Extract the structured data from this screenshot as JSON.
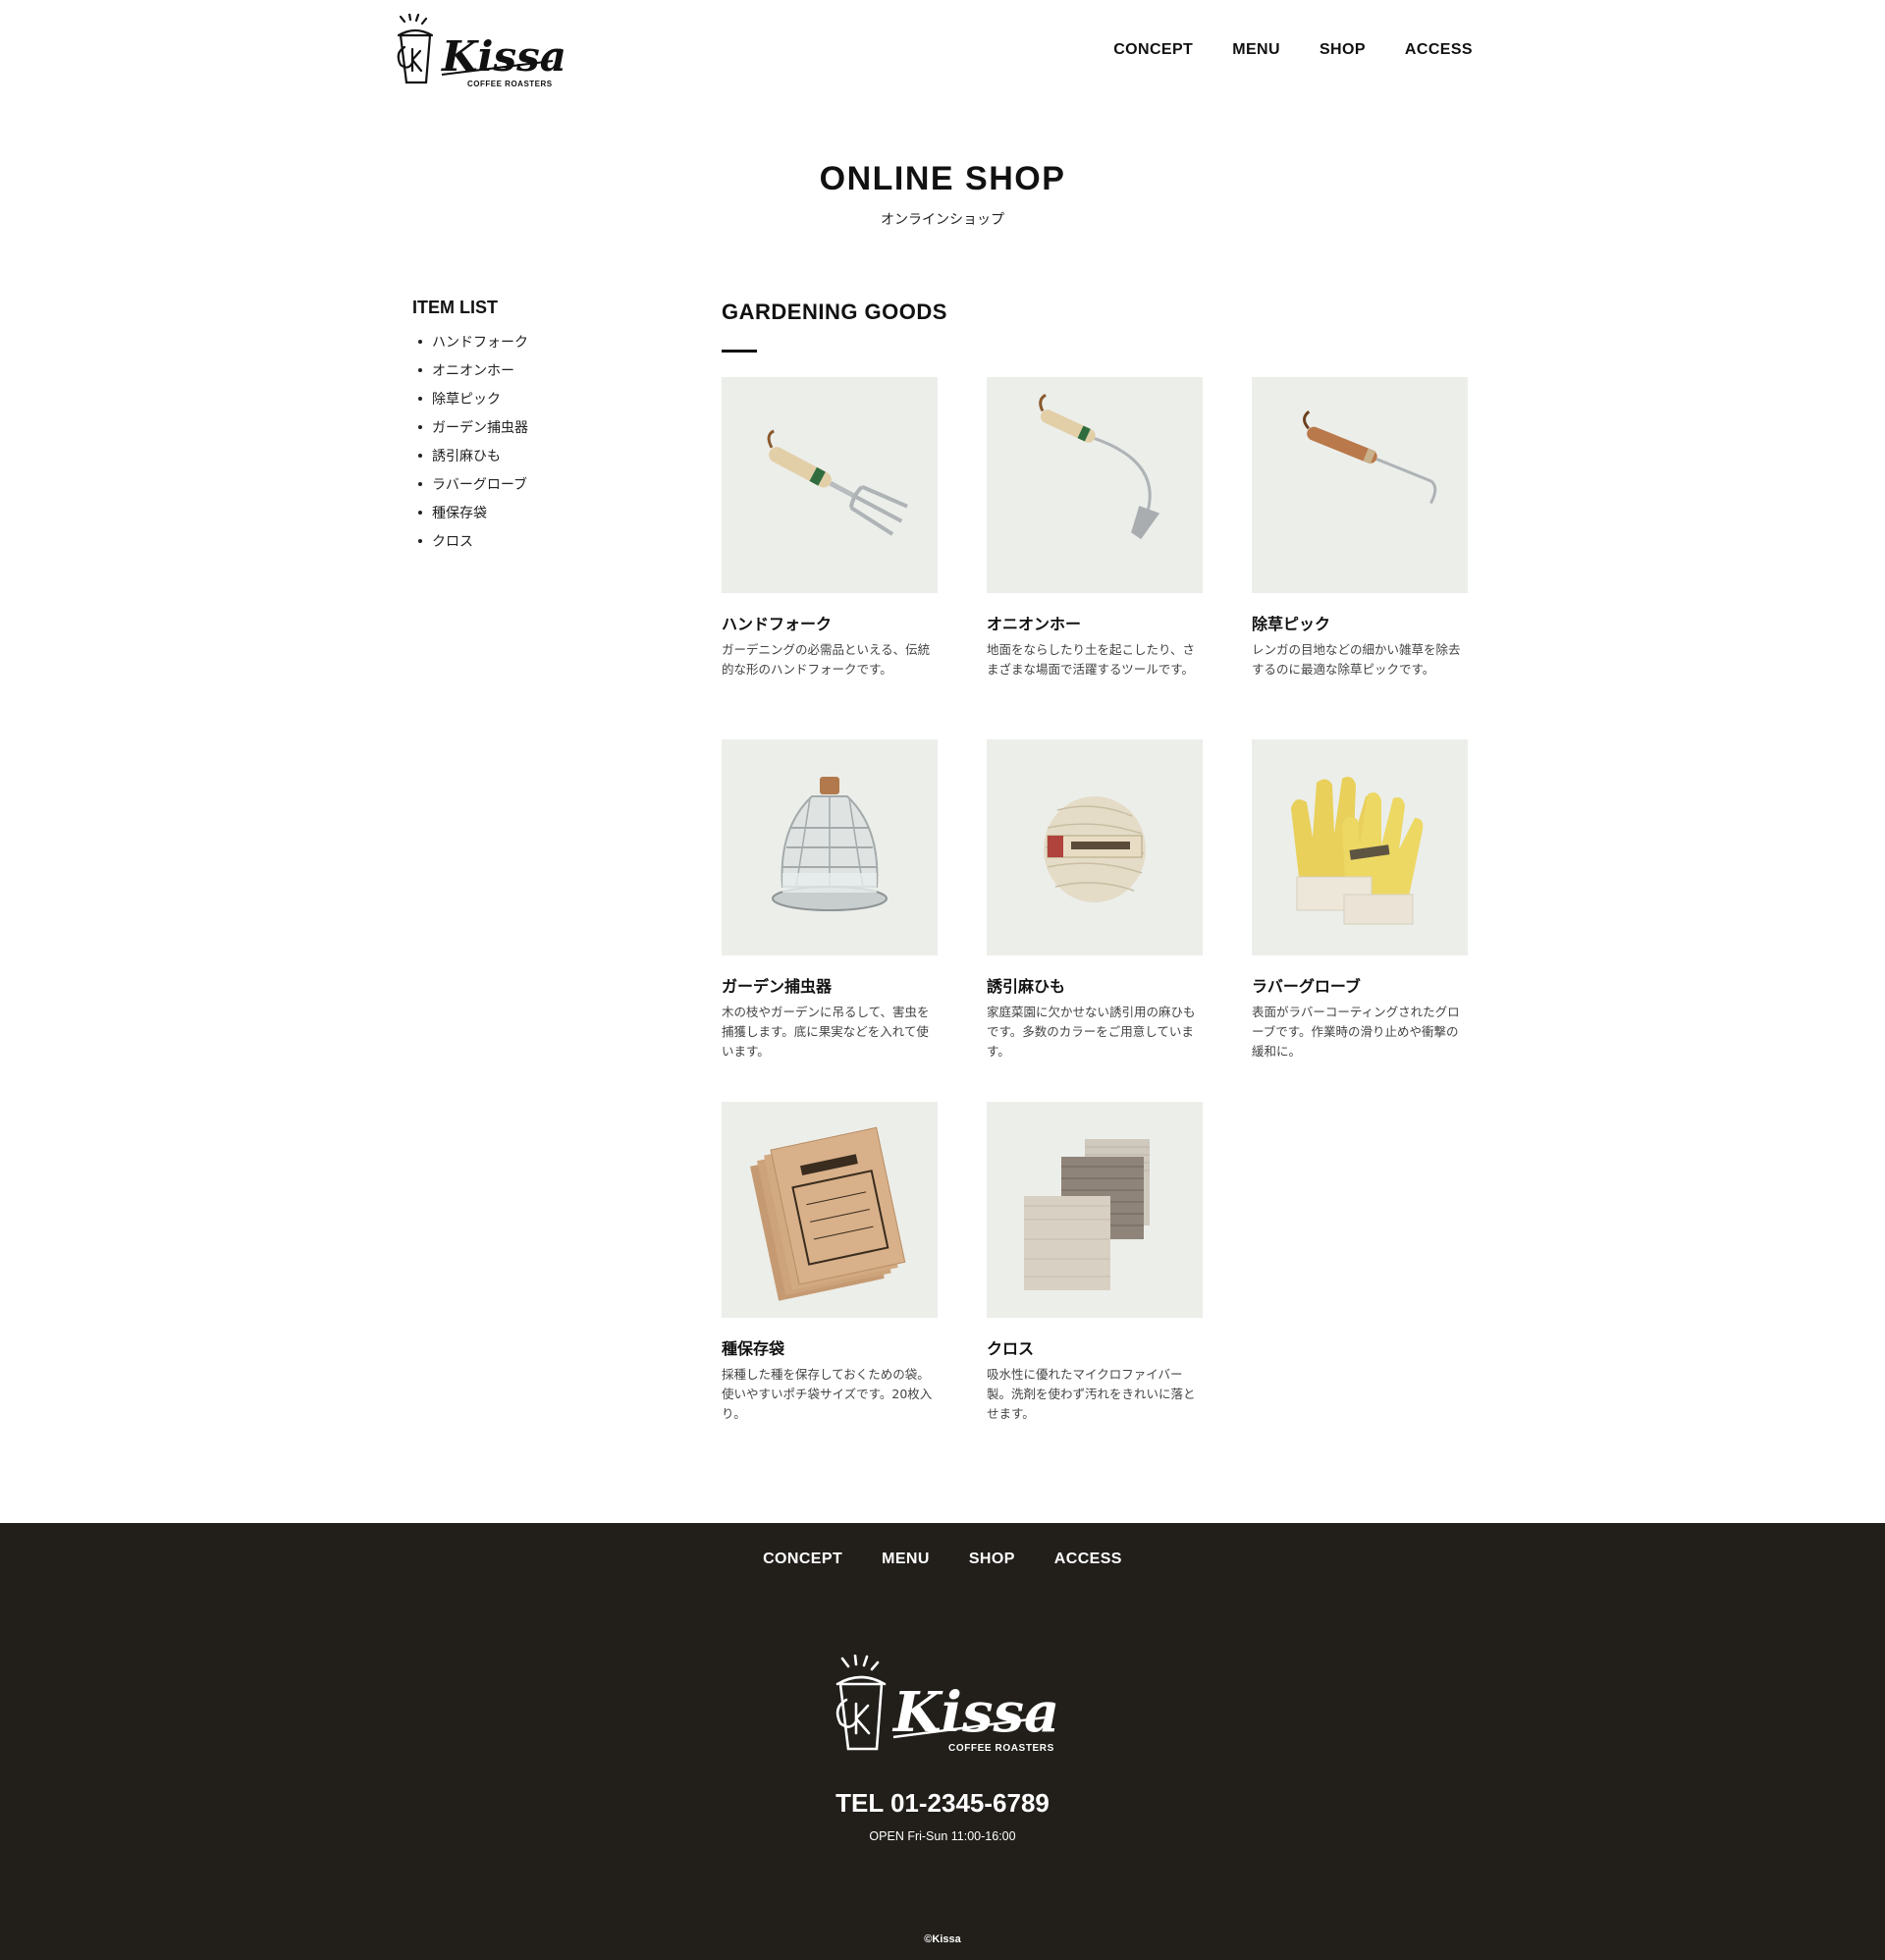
{
  "header": {
    "logo_text": "Kissa",
    "logo_sub": "COFFEE ROASTERS",
    "nav": [
      "CONCEPT",
      "MENU",
      "SHOP",
      "ACCESS"
    ]
  },
  "page": {
    "title": "ONLINE SHOP",
    "subtitle": "オンラインショップ"
  },
  "sidebar": {
    "title": "ITEM LIST",
    "items": [
      "ハンドフォーク",
      "オニオンホー",
      "除草ピック",
      "ガーデン捕虫器",
      "誘引麻ひも",
      "ラバーグローブ",
      "種保存袋",
      "クロス"
    ]
  },
  "section": {
    "title": "GARDENING GOODS"
  },
  "products": [
    {
      "name": "ハンドフォーク",
      "desc": "ガーデニングの必需品といえる、伝統的な形のハンドフォークです。",
      "icon": "hand-fork-image"
    },
    {
      "name": "オニオンホー",
      "desc": "地面をならしたり土を起こしたり、さまざまな場面で活躍するツールです。",
      "icon": "onion-hoe-image"
    },
    {
      "name": "除草ピック",
      "desc": "レンガの目地などの細かい雑草を除去するのに最適な除草ピックです。",
      "icon": "weeding-pick-image"
    },
    {
      "name": "ガーデン捕虫器",
      "desc": "木の枝やガーデンに吊るして、害虫を捕獲します。底に果実などを入れて使います。",
      "icon": "insect-trap-image"
    },
    {
      "name": "誘引麻ひも",
      "desc": "家庭菜園に欠かせない誘引用の麻ひもです。多数のカラーをご用意しています。",
      "icon": "twine-ball-image"
    },
    {
      "name": "ラバーグローブ",
      "desc": "表面がラバーコーティングされたグローブです。作業時の滑り止めや衝撃の緩和に。",
      "icon": "rubber-gloves-image"
    },
    {
      "name": "種保存袋",
      "desc": "採種した種を保存しておくための袋。使いやすいポチ袋サイズです。20枚入り。",
      "icon": "seed-bags-image"
    },
    {
      "name": "クロス",
      "desc": "吸水性に優れたマイクロファイバー製。洗剤を使わず汚れをきれいに落とせます。",
      "icon": "cloths-image"
    }
  ],
  "footer": {
    "nav": [
      "CONCEPT",
      "MENU",
      "SHOP",
      "ACCESS"
    ],
    "tel": "TEL 01-2345-6789",
    "open": "OPEN Fri-Sun 11:00-16:00",
    "copyright": "©Kissa"
  },
  "colors": {
    "footer_bg": "#221f1b",
    "text": "#111111",
    "image_bg": "#eceeea"
  }
}
